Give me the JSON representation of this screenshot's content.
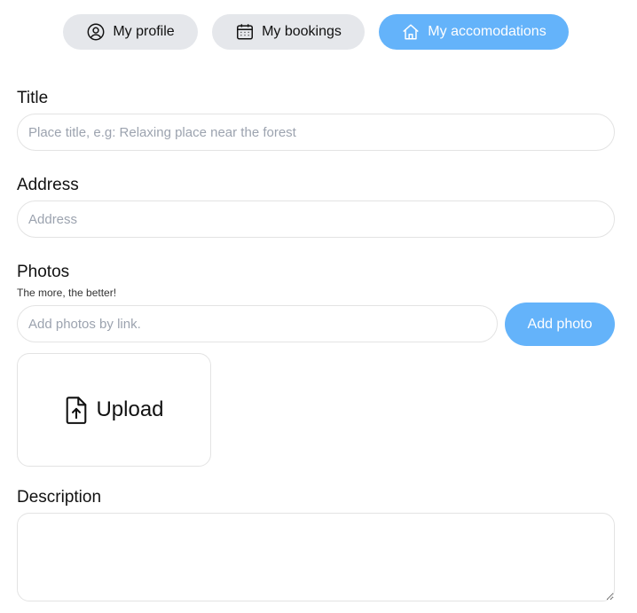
{
  "nav": {
    "tabs": [
      {
        "label": "My profile",
        "icon": "user-circle-icon",
        "active": false
      },
      {
        "label": "My bookings",
        "icon": "calendar-icon",
        "active": false
      },
      {
        "label": "My accomodations",
        "icon": "home-icon",
        "active": true
      }
    ]
  },
  "form": {
    "title": {
      "label": "Title",
      "placeholder": "Place title, e.g: Relaxing place near the forest"
    },
    "address": {
      "label": "Address",
      "placeholder": "Address"
    },
    "photos": {
      "label": "Photos",
      "hint": "The more, the better!",
      "placeholder": "Add photos by link.",
      "add_button": "Add photo",
      "upload_label": "Upload",
      "upload_icon": "file-upload-icon"
    },
    "description": {
      "label": "Description"
    }
  },
  "colors": {
    "accent": "#64b3fa",
    "tab_inactive": "#e5e7eb"
  }
}
